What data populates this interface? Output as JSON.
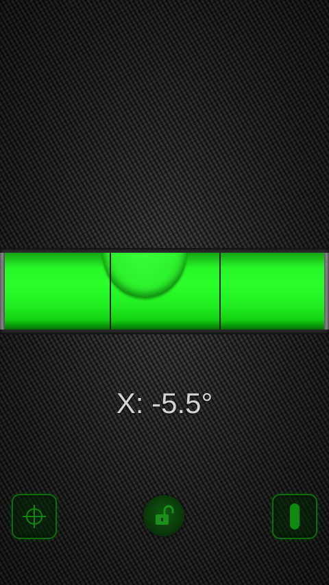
{
  "level": {
    "axis_label": "X",
    "reading_text": "X: -5.5°",
    "angle_degrees": -5.5
  },
  "controls": {
    "calibrate_icon": "crosshair-icon",
    "lock_icon": "unlocked-padlock-icon",
    "orientation_icon": "vertical-bar-icon"
  },
  "colors": {
    "bubble_fluid": "#2cff2c",
    "accent_green": "#0c6f0c",
    "reading_text": "#d4d4d4",
    "background": "#1a1a1a"
  }
}
